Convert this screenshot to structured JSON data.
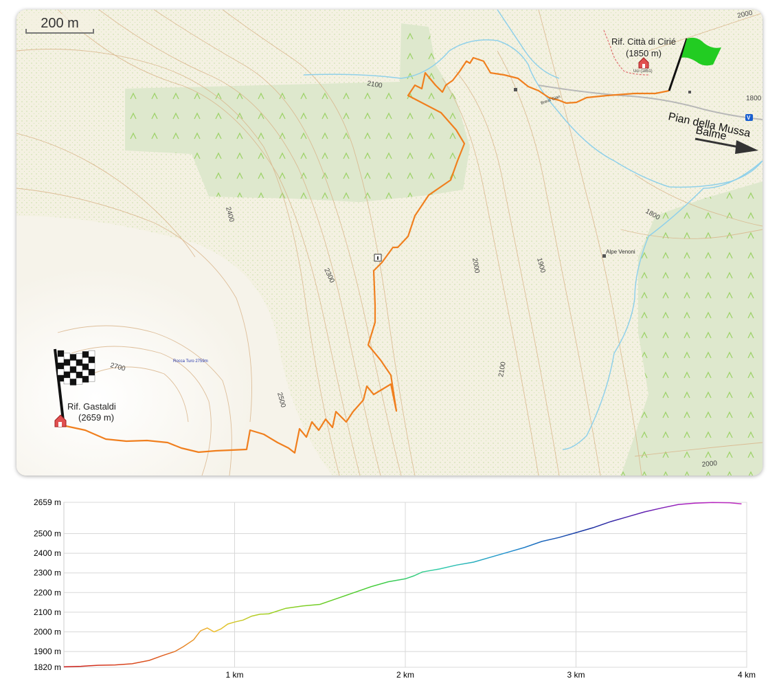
{
  "scale_bar": {
    "label": "200 m"
  },
  "map": {
    "huts": [
      {
        "name": "Rif. Città di Cirié",
        "altitude": "(1850 m)"
      },
      {
        "name": "Rif. Gastaldi",
        "altitude": "(2659 m)"
      }
    ],
    "places": {
      "pian_della_mussa": "Pian della Mussa",
      "balme": "Balme",
      "alpe_venoni": "Alpe Venoni",
      "rocca_turo": "Rocca Turo 2759m",
      "small_label": "Uci (1851)",
      "bridge_label": "Breuil Gian"
    },
    "contour_labels": [
      "2000",
      "1800",
      "2100",
      "2400",
      "2300",
      "2000",
      "1900",
      "1800",
      "2700",
      "2500",
      "2100",
      "2000"
    ],
    "icons": [
      "start-flag-icon",
      "finish-flag-icon",
      "hut-icon",
      "info-icon",
      "bus-stop-icon",
      "direction-arrow-icon"
    ],
    "colors": {
      "route": "#f07f1e",
      "start_flag": "#22cc22",
      "forest": "#dde7c9",
      "stream": "#8fd0ea"
    }
  },
  "chart_data": {
    "type": "area",
    "title": "",
    "xlabel": "",
    "ylabel": "",
    "xlim": [
      0,
      4
    ],
    "ylim": [
      1820,
      2659
    ],
    "x_tick_labels": [
      "1 km",
      "2 km",
      "3 km",
      "4 km"
    ],
    "x_ticks": [
      1,
      2,
      3,
      4
    ],
    "y_tick_labels": [
      "2659 m",
      "2500 m",
      "2400 m",
      "2300 m",
      "2200 m",
      "2100 m",
      "2000 m",
      "1900 m",
      "1820 m"
    ],
    "y_ticks": [
      2659,
      2500,
      2400,
      2300,
      2200,
      2100,
      2000,
      1900,
      1820
    ],
    "grid": true,
    "colormap": "elevation gradient: red (low) to magenta (high)",
    "series": [
      {
        "x": [
          0,
          0.1,
          0.2,
          0.3,
          0.4,
          0.5,
          0.58,
          0.65,
          0.7,
          0.76,
          0.8,
          0.84,
          0.88,
          0.92,
          0.96,
          1.0,
          1.05,
          1.1,
          1.15,
          1.2,
          1.3,
          1.4,
          1.5,
          1.6,
          1.7,
          1.8,
          1.9,
          2.0,
          2.05,
          2.1,
          2.2,
          2.3,
          2.4,
          2.5,
          2.6,
          2.7,
          2.8,
          2.9,
          3.0,
          3.1,
          3.2,
          3.3,
          3.4,
          3.5,
          3.6,
          3.7,
          3.8,
          3.9,
          3.97
        ],
        "y": [
          1822,
          1825,
          1830,
          1832,
          1838,
          1855,
          1880,
          1900,
          1925,
          1960,
          2005,
          2020,
          2000,
          2015,
          2040,
          2050,
          2060,
          2080,
          2090,
          2092,
          2120,
          2132,
          2140,
          2170,
          2200,
          2230,
          2255,
          2270,
          2285,
          2305,
          2320,
          2340,
          2355,
          2380,
          2405,
          2430,
          2460,
          2480,
          2505,
          2530,
          2560,
          2585,
          2610,
          2630,
          2648,
          2655,
          2658,
          2657,
          2651
        ]
      }
    ]
  }
}
